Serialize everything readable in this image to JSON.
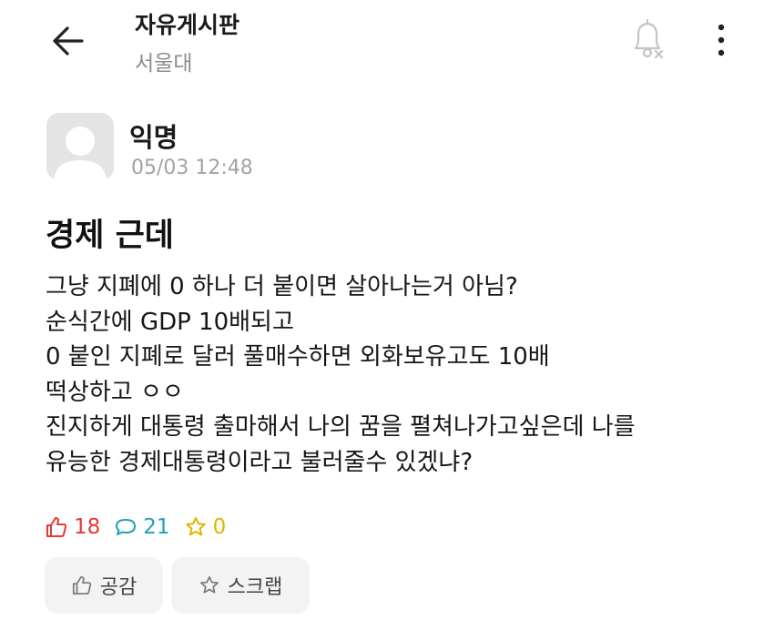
{
  "header": {
    "board_title": "자유게시판",
    "school": "서울대"
  },
  "post": {
    "author": "익명",
    "date": "05/03 12:48",
    "title": "경제 근데",
    "body_lines": [
      "그냥 지폐에 0 하나 더 붙이면 살아나는거 아님?",
      "순식간에 GDP 10배되고",
      "0 붙인 지폐로 달러 풀매수하면 외화보유고도 10배",
      "떡상하고 ㅇㅇ",
      "진지하게 대통령 출마해서 나의 꿈을 펼쳐나가고싶은데 나를",
      "유능한 경제대통령이라고 불러줄수 있겠냐?"
    ],
    "stats": {
      "likes": "18",
      "comments": "21",
      "scraps": "0"
    }
  },
  "actions": {
    "like_label": "공감",
    "scrap_label": "스크랩"
  },
  "colors": {
    "like": "#e53935",
    "comment": "#1aa3b8",
    "scrap": "#e0b500",
    "muted": "#a3a3a3"
  },
  "icons": {
    "back": "arrow-left-icon",
    "bell": "bell-off-icon",
    "more": "more-vertical-icon",
    "like": "thumbs-up-icon",
    "comment": "speech-bubble-icon",
    "scrap": "star-icon"
  }
}
